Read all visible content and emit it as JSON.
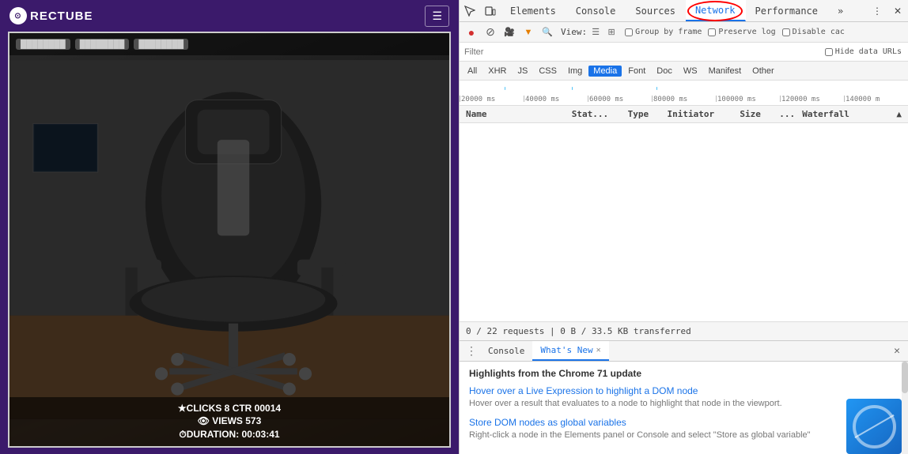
{
  "app": {
    "name": "RECTUBE",
    "logo_char": "⊙"
  },
  "header": {
    "hamburger_label": "☰"
  },
  "video": {
    "top_bar_items": [
      "[blurred text]",
      "[blurred text]",
      "[blurred text]"
    ],
    "stats": {
      "clicks": "★CLICKS 8  CTR 00014",
      "views": "👁 VIEWS 573",
      "duration": "⏱DURATION: 00:03:41"
    }
  },
  "devtools": {
    "tabs": [
      {
        "label": "Elements",
        "active": false
      },
      {
        "label": "Console",
        "active": false
      },
      {
        "label": "Sources",
        "active": false
      },
      {
        "label": "Network",
        "active": true
      },
      {
        "label": "Performance",
        "active": false
      },
      {
        "label": "»",
        "active": false
      }
    ],
    "toolbar": {
      "record_title": "●",
      "stop_title": "⊘",
      "video_title": "🎥",
      "filter_title": "▼",
      "search_title": "🔍",
      "view_label": "View:",
      "list_icon": "☰",
      "grid_icon": "⊞",
      "group_by_frame": "Group by frame",
      "preserve_log": "Preserve log",
      "disable_cache": "Disable cac"
    },
    "filter": {
      "placeholder": "Filter",
      "hide_data_urls": "Hide data URLs"
    },
    "type_filters": [
      "All",
      "XHR",
      "JS",
      "CSS",
      "Img",
      "Media",
      "Font",
      "Doc",
      "WS",
      "Manifest",
      "Other"
    ],
    "active_type_filter": "Media",
    "timeline": {
      "marks": [
        "20000 ms",
        "40000 ms",
        "60000 ms",
        "80000 ms",
        "100000 ms",
        "120000 ms",
        "140000 m"
      ]
    },
    "table_headers": [
      "Name",
      "Stat...",
      "Type",
      "Initiator",
      "Size",
      "...",
      "Waterfall",
      "▲"
    ],
    "status": "0 / 22 requests  |  0 B / 33.5 KB transferred"
  },
  "bottom_panel": {
    "tabs": [
      {
        "label": "Console",
        "active": false
      },
      {
        "label": "What's New",
        "active": true
      },
      {
        "close_label": "✕"
      }
    ],
    "close_btn": "✕",
    "trigger_icon": "⋮",
    "whats_new": {
      "title": "Highlights from the Chrome 71 update",
      "features": [
        {
          "title": "Hover over a Live Expression to highlight a DOM node",
          "description": "Hover over a result that evaluates to a node to highlight that node in the viewport."
        },
        {
          "title": "Store DOM nodes as global variables",
          "description": "Right-click a node in the Elements panel or Console and select \"Store as global variable\""
        }
      ]
    }
  }
}
